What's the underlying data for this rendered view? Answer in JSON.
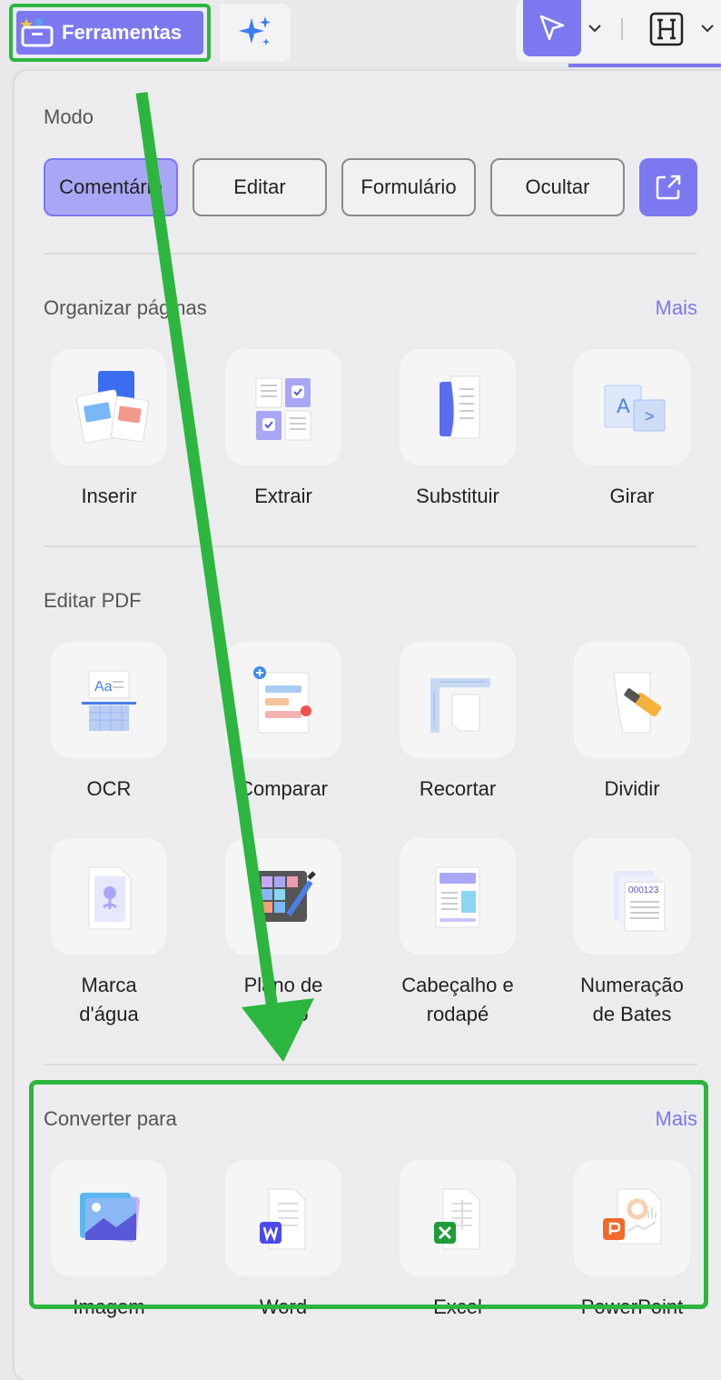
{
  "toolbar": {
    "tools_tab_label": "Ferramentas",
    "ai_icon": "sparkle-icon",
    "cursor_icon": "cursor-icon",
    "heading_icon": "heading-h-icon",
    "accent_color": "#7b78f0"
  },
  "mode": {
    "title": "Modo",
    "buttons": [
      "Comentário",
      "Editar",
      "Formulário",
      "Ocultar"
    ],
    "active": "Comentário"
  },
  "organize": {
    "title": "Organizar páginas",
    "more": "Mais",
    "items": [
      {
        "label": "Inserir",
        "icon": "insert-pages-icon"
      },
      {
        "label": "Extrair",
        "icon": "extract-pages-icon"
      },
      {
        "label": "Substituir",
        "icon": "replace-pages-icon"
      },
      {
        "label": "Girar",
        "icon": "rotate-pages-icon"
      }
    ]
  },
  "edit_pdf": {
    "title": "Editar PDF",
    "items": [
      {
        "label": "OCR",
        "icon": "ocr-icon"
      },
      {
        "label": "Comparar",
        "icon": "compare-icon"
      },
      {
        "label": "Recortar",
        "icon": "crop-icon"
      },
      {
        "label": "Dividir",
        "icon": "split-icon"
      },
      {
        "label": "Marca\nd'água",
        "l1": "Marca",
        "l2": "d'água",
        "icon": "watermark-icon"
      },
      {
        "label": "Plano de fundo",
        "l1": "Plano de",
        "l2": "fundo",
        "icon": "background-icon"
      },
      {
        "label": "Cabeçalho e rodapé",
        "l1": "Cabeçalho e",
        "l2": "rodapé",
        "icon": "header-footer-icon"
      },
      {
        "label": "Numeração de Bates",
        "l1": "Numeração",
        "l2": "de Bates",
        "icon": "bates-numbering-icon"
      }
    ]
  },
  "convert": {
    "title": "Converter para",
    "more": "Mais",
    "items": [
      {
        "label": "Imagem",
        "icon": "image-file-icon"
      },
      {
        "label": "Word",
        "icon": "word-file-icon"
      },
      {
        "label": "Excel",
        "icon": "excel-file-icon"
      },
      {
        "label": "PowerPoint",
        "icon": "powerpoint-file-icon"
      }
    ]
  },
  "bates_sample": "000123",
  "ocr_sample": "Aa",
  "rotate_sample_a": "A",
  "rotate_sample_arrow": ">"
}
